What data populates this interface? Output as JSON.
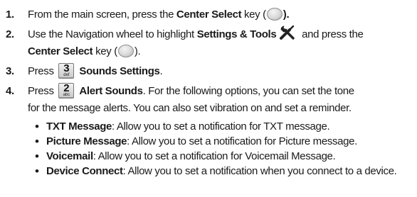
{
  "steps": [
    {
      "number": "1.",
      "text_a": "From the main screen, press the ",
      "bold_a": "Center Select",
      "text_b": " key (",
      "text_c": ")."
    },
    {
      "number": "2.",
      "text_a": "Use the Navigation wheel to highlight ",
      "bold_a": "Settings & Tools",
      "text_b": " and press the",
      "bold_b": "Center Select",
      "text_c": " key (",
      "text_d": ")."
    },
    {
      "number": "3.",
      "text_a": "Press",
      "key_number": "3",
      "key_letters": "def",
      "bold_a": "Sounds Settings",
      "text_b": "."
    },
    {
      "number": "4.",
      "text_a": "Press",
      "key_number": "2",
      "key_letters": "abc",
      "bold_a": "Alert Sounds",
      "text_b": ". For the following options, you can set the tone",
      "text_c": "for the message alerts. You can also set vibration on and set a reminder."
    }
  ],
  "options": [
    {
      "term": "TXT Message",
      "desc": ": Allow you to set a notification for TXT message."
    },
    {
      "term": "Picture Message",
      "desc": ": Allow you to set a notification for Picture message."
    },
    {
      "term": "Voicemail",
      "desc": ": Allow you to set a notification for Voicemail Message."
    },
    {
      "term": "Device Connect",
      "desc": ": Allow you to set a notification when you connect to a device."
    }
  ],
  "icons": {
    "center_select": "center-select-key-icon",
    "settings_tools": "settings-tools-icon"
  }
}
